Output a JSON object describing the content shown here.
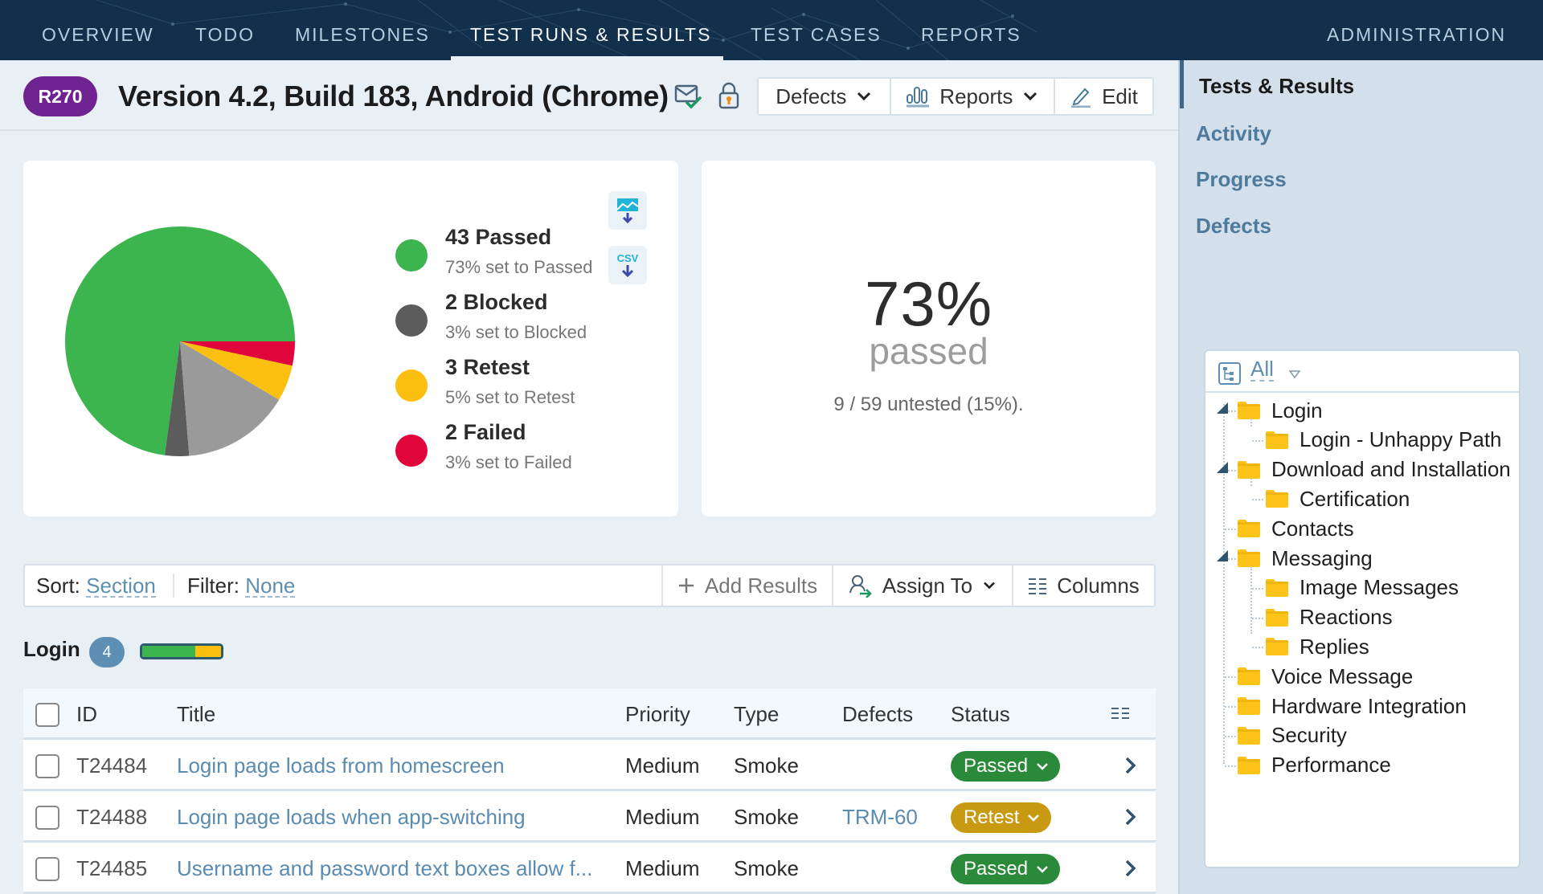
{
  "nav": {
    "items": [
      {
        "label": "OVERVIEW",
        "active": false
      },
      {
        "label": "TODO",
        "active": false
      },
      {
        "label": "MILESTONES",
        "active": false
      },
      {
        "label": "TEST RUNS & RESULTS",
        "active": true
      },
      {
        "label": "TEST CASES",
        "active": false
      },
      {
        "label": "REPORTS",
        "active": false
      }
    ],
    "admin_label": "ADMINISTRATION"
  },
  "header": {
    "run_id": "R270",
    "title": "Version 4.2, Build 183, Android (Chrome)",
    "icons": [
      "email-check-icon",
      "lock-icon"
    ],
    "buttons": {
      "defects": "Defects",
      "reports": "Reports",
      "edit": "Edit"
    }
  },
  "summary": {
    "legend": [
      {
        "title": "43 Passed",
        "sub": "73% set to Passed",
        "color": "#3cb54e"
      },
      {
        "title": "2 Blocked",
        "sub": "3% set to Blocked",
        "color": "#5c5c5c"
      },
      {
        "title": "3 Retest",
        "sub": "5% set to Retest",
        "color": "#fbbf0f"
      },
      {
        "title": "2 Failed",
        "sub": "3% set to Failed",
        "color": "#e0063c"
      }
    ],
    "export_buttons": [
      "export-image-icon",
      "export-csv-icon"
    ],
    "csv_label": "CSV",
    "percent": "73%",
    "percent_label": "passed",
    "untested_text": "9 / 59 untested (15%)."
  },
  "chart_data": {
    "type": "pie",
    "title": "",
    "total": 59,
    "slices": [
      {
        "label": "Passed",
        "value": 43,
        "color": "#3cb54e"
      },
      {
        "label": "Blocked",
        "value": 2,
        "color": "#5c5c5c"
      },
      {
        "label": "Untested",
        "value": 9,
        "color": "#9a9a9a"
      },
      {
        "label": "Retest",
        "value": 3,
        "color": "#fbbf0f"
      },
      {
        "label": "Failed",
        "value": 2,
        "color": "#e0063c"
      }
    ],
    "legend_position": "right"
  },
  "toolbar": {
    "sort_label": "Sort:",
    "sort_value": "Section",
    "filter_label": "Filter:",
    "filter_value": "None",
    "add_results": "Add Results",
    "assign_to": "Assign To",
    "columns": "Columns"
  },
  "section": {
    "title": "Login",
    "count": "4",
    "progress": {
      "passed": 0.67,
      "retest": 0.33
    }
  },
  "table": {
    "headers": {
      "id": "ID",
      "title": "Title",
      "priority": "Priority",
      "type": "Type",
      "defects": "Defects",
      "status": "Status"
    },
    "rows": [
      {
        "id": "T24484",
        "title": "Login page loads from homescreen",
        "priority": "Medium",
        "type": "Smoke",
        "defects": "",
        "status": "Passed",
        "status_color": "#2a8a3a"
      },
      {
        "id": "T24488",
        "title": "Login page loads when app-switching",
        "priority": "Medium",
        "type": "Smoke",
        "defects": "TRM-60",
        "status": "Retest",
        "status_color": "#c79a12"
      },
      {
        "id": "T24485",
        "title": "Username and password text boxes allow f...",
        "priority": "Medium",
        "type": "Smoke",
        "defects": "",
        "status": "Passed",
        "status_color": "#2a8a3a"
      }
    ]
  },
  "sidebar": {
    "items": [
      {
        "label": "Tests & Results",
        "active": true
      },
      {
        "label": "Activity",
        "active": false
      },
      {
        "label": "Progress",
        "active": false
      },
      {
        "label": "Defects",
        "active": false
      }
    ],
    "tree": {
      "filter_label": "All",
      "nodes": [
        {
          "label": "Login",
          "level": 0,
          "expanded": true
        },
        {
          "label": "Login - Unhappy Path",
          "level": 1
        },
        {
          "label": "Download and Installation",
          "level": 0,
          "expanded": true
        },
        {
          "label": "Certification",
          "level": 1
        },
        {
          "label": "Contacts",
          "level": 0
        },
        {
          "label": "Messaging",
          "level": 0,
          "expanded": true
        },
        {
          "label": "Image Messages",
          "level": 1
        },
        {
          "label": "Reactions",
          "level": 1
        },
        {
          "label": "Replies",
          "level": 1
        },
        {
          "label": "Voice Message",
          "level": 0
        },
        {
          "label": "Hardware Integration",
          "level": 0
        },
        {
          "label": "Security",
          "level": 0
        },
        {
          "label": "Performance",
          "level": 0
        }
      ]
    }
  }
}
